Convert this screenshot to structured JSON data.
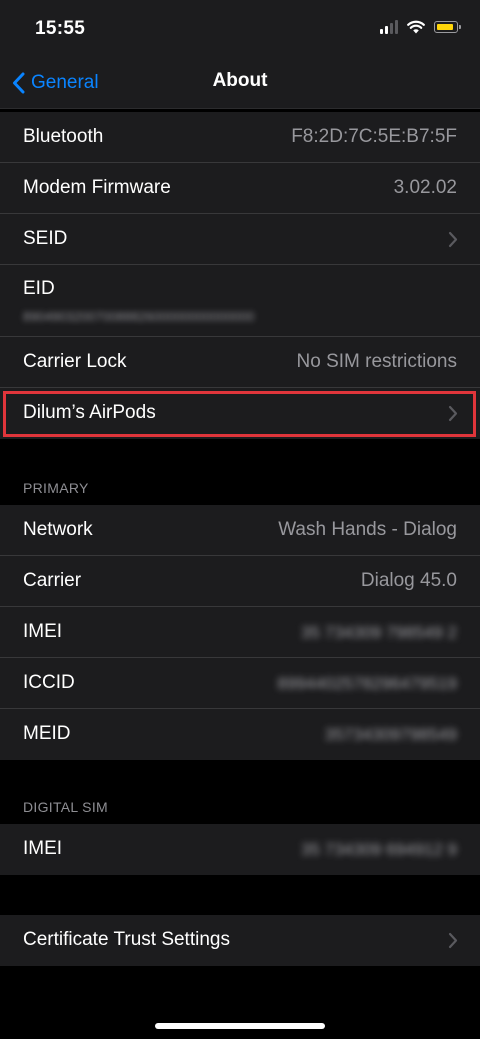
{
  "status_bar": {
    "time": "15:55"
  },
  "nav": {
    "back_label": "General",
    "title": "About"
  },
  "group1": {
    "rows": [
      {
        "label": "Bluetooth",
        "value": "F8:2D:7C:5E:B7:5F"
      },
      {
        "label": "Modem Firmware",
        "value": "3.02.02"
      },
      {
        "label": "SEID"
      },
      {
        "label": "EID",
        "subvalue": "89049032007008882600000000000000"
      },
      {
        "label": "Carrier Lock",
        "value": "No SIM restrictions"
      },
      {
        "label": "Dilum’s AirPods"
      }
    ]
  },
  "primary": {
    "header": "PRIMARY",
    "rows": [
      {
        "label": "Network",
        "value": "Wash Hands - Dialog"
      },
      {
        "label": "Carrier",
        "value": "Dialog 45.0"
      },
      {
        "label": "IMEI",
        "value": "35 734309 798549 2"
      },
      {
        "label": "ICCID",
        "value": "8994402578296479519"
      },
      {
        "label": "MEID",
        "value": "35734309798549"
      }
    ]
  },
  "digital_sim": {
    "header": "DIGITAL SIM",
    "rows": [
      {
        "label": "IMEI",
        "value": "35 734309 694912 9"
      }
    ]
  },
  "certificate": {
    "label": "Certificate Trust Settings"
  },
  "colors": {
    "accent": "#0a84ff",
    "highlight": "#e0353b",
    "battery": "#ffd60a"
  }
}
